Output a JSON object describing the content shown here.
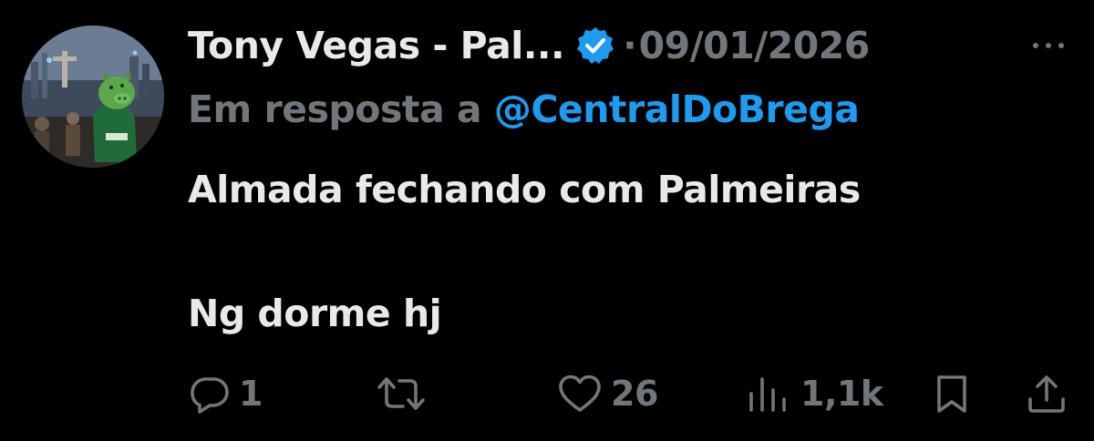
{
  "tweet": {
    "display_name": "Tony Vegas - Pal...",
    "separator": "·",
    "date": "09/01/2026",
    "reply_prefix": "Em resposta a",
    "reply_handle": "@CentralDoBrega",
    "text_line1": "Almada fechando com Palmeiras",
    "text_line2": "Ng dorme hj",
    "icons": {
      "verified": "verified-badge-icon",
      "more": "more-options-icon",
      "reply": "reply-icon",
      "retweet": "retweet-icon",
      "like": "heart-icon",
      "views": "views-chart-icon",
      "bookmark": "bookmark-icon",
      "share": "share-icon"
    }
  },
  "actions": {
    "replies": "1",
    "likes": "26",
    "views": "1,1k"
  },
  "colors": {
    "background": "#000000",
    "primary_text": "#e7e9ea",
    "secondary_text": "#71767b",
    "accent": "#1d9bf0",
    "avatar_pig": "#5aa84a",
    "avatar_shirt": "#1f6b3a"
  }
}
